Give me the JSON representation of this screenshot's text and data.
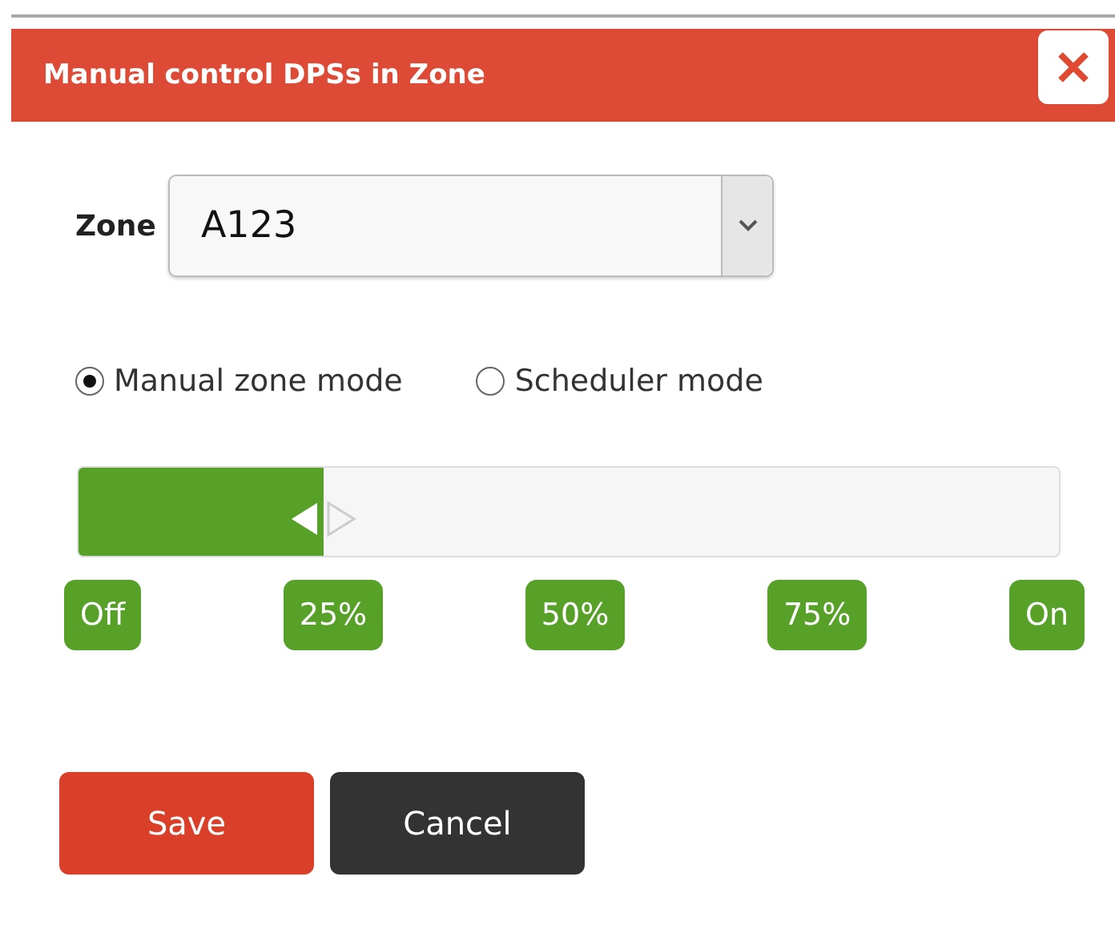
{
  "dialog": {
    "title": "Manual control DPSs in Zone"
  },
  "zone": {
    "label": "Zone",
    "value": "A123"
  },
  "modes": [
    {
      "label": "Manual zone mode",
      "selected": true
    },
    {
      "label": "Scheduler mode",
      "selected": false
    }
  ],
  "slider": {
    "level": 0.25,
    "ticks": [
      "Off",
      "25%",
      "50%",
      "75%",
      "On"
    ]
  },
  "buttons": [
    {
      "label": "Save",
      "kind": "primary"
    },
    {
      "label": "Cancel",
      "kind": "secondary"
    }
  ]
}
